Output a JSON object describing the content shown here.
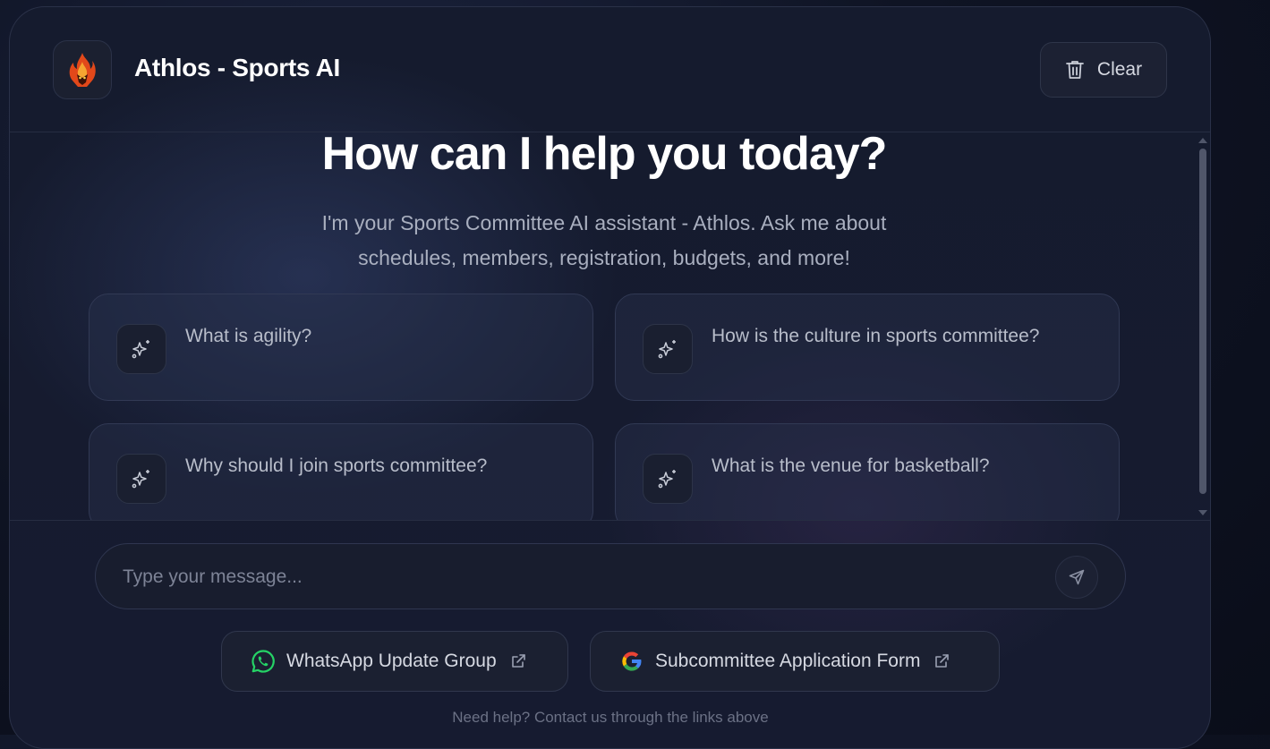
{
  "header": {
    "title": "Athlos - Sports AI",
    "clear_label": "Clear",
    "logo_icon": "flame-logo-icon",
    "clear_icon": "trash-icon"
  },
  "welcome": {
    "heading": "How can I help you today?",
    "subtitle_line1": "I'm your Sports Committee AI assistant - Athlos. Ask me about",
    "subtitle_line2": "schedules, members, registration, budgets, and more!"
  },
  "suggestions": [
    {
      "label": "What is agility?",
      "icon": "sparkles-icon"
    },
    {
      "label": "How is the culture in sports committee?",
      "icon": "sparkles-icon"
    },
    {
      "label": "Why should I join sports committee?",
      "icon": "sparkles-icon"
    },
    {
      "label": "What is the venue for basketball?",
      "icon": "sparkles-icon"
    }
  ],
  "composer": {
    "placeholder": "Type your message...",
    "value": "",
    "send_icon": "send-icon"
  },
  "links": [
    {
      "label": "WhatsApp Update Group",
      "icon": "whatsapp-icon"
    },
    {
      "label": "Subcommittee Application Form",
      "icon": "google-icon"
    }
  ],
  "footer": {
    "help_text": "Need help? Contact us through the links above"
  },
  "colors": {
    "background": "#0f1424",
    "card": "#151b2e",
    "whatsapp_green": "#25d366",
    "flame_orange": "#e8551f"
  }
}
